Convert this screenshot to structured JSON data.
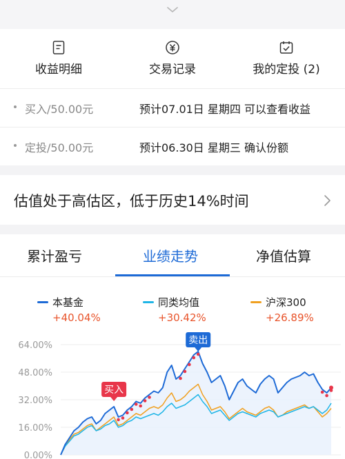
{
  "header": {
    "collapse_icon": "chevron-down-icon"
  },
  "actions": [
    {
      "label": "收益明细",
      "icon": "document-icon"
    },
    {
      "label": "交易记录",
      "icon": "yen-circle-icon"
    },
    {
      "label": "我的定投 (2)",
      "icon": "calendar-check-icon"
    }
  ],
  "pending": [
    {
      "key": "买入/50.00元",
      "value": "预计07.01日 星期四 可以查看收益"
    },
    {
      "key": "定投/50.00元",
      "value": "预计06.30日 星期三 确认份额"
    }
  ],
  "valuation": {
    "text": "估值处于高估区，低于历史14%时间",
    "arrow_icon": "chevron-right-icon"
  },
  "tabs": [
    {
      "label": "累计盈亏",
      "active": false
    },
    {
      "label": "业绩走势",
      "active": true
    },
    {
      "label": "净值估算",
      "active": false
    }
  ],
  "colors": {
    "accent": "#1d6ad6",
    "up": "#e8532a",
    "sell_tag": "#1d6ad6",
    "buy_tag": "#e8364a"
  },
  "chart_data": {
    "type": "line",
    "y_ticks": [
      "64.00%",
      "48.00%",
      "32.00%",
      "16.00%",
      "0.00%"
    ],
    "ylim": [
      0,
      64
    ],
    "grid": true,
    "legend_position": "top",
    "series": [
      {
        "name": "本基金",
        "change": "+40.04%",
        "color": "#1d6ad6",
        "values": [
          0,
          6,
          10,
          14,
          16,
          19,
          21,
          22,
          18,
          20,
          24,
          26,
          28,
          22,
          23,
          26,
          28,
          31,
          30,
          33,
          35,
          37,
          36,
          39,
          48,
          52,
          44,
          46,
          50,
          54,
          58,
          60,
          53,
          48,
          42,
          44,
          46,
          40,
          32,
          37,
          42,
          44,
          40,
          38,
          36,
          41,
          44,
          46,
          44,
          36,
          39,
          42,
          44,
          45,
          46,
          48,
          46,
          47,
          42,
          38,
          36,
          39
        ]
      },
      {
        "name": "同类均值",
        "change": "+30.42%",
        "color": "#1fb5e6",
        "values": [
          0,
          5,
          8,
          11,
          12,
          14,
          16,
          17,
          14,
          15,
          17,
          18,
          20,
          16,
          17,
          19,
          20,
          22,
          21,
          22,
          23,
          24,
          23,
          25,
          28,
          30,
          27,
          28,
          29,
          31,
          33,
          35,
          31,
          28,
          24,
          25,
          26,
          23,
          20,
          22,
          24,
          25,
          24,
          23,
          22,
          24,
          25,
          26,
          25,
          22,
          23,
          24,
          25,
          26,
          27,
          28,
          27,
          28,
          26,
          24,
          26,
          30
        ]
      },
      {
        "name": "沪深300",
        "change": "+26.89%",
        "color": "#f0a020",
        "values": [
          0,
          5,
          9,
          12,
          13,
          15,
          17,
          18,
          14,
          16,
          18,
          20,
          22,
          17,
          18,
          20,
          22,
          24,
          23,
          25,
          27,
          28,
          27,
          29,
          33,
          36,
          31,
          32,
          34,
          37,
          39,
          41,
          35,
          31,
          26,
          27,
          28,
          25,
          21,
          23,
          25,
          27,
          25,
          24,
          23,
          25,
          27,
          28,
          26,
          22,
          23,
          25,
          26,
          27,
          28,
          29,
          27,
          28,
          25,
          22,
          24,
          27
        ]
      }
    ],
    "annotations": [
      {
        "label": "买入",
        "x_index": 12,
        "series": "本基金"
      },
      {
        "label": "卖出",
        "x_index": 31,
        "series": "本基金"
      }
    ],
    "marker_segments": [
      [
        13,
        20
      ],
      [
        27,
        31
      ],
      [
        59,
        61
      ]
    ]
  }
}
